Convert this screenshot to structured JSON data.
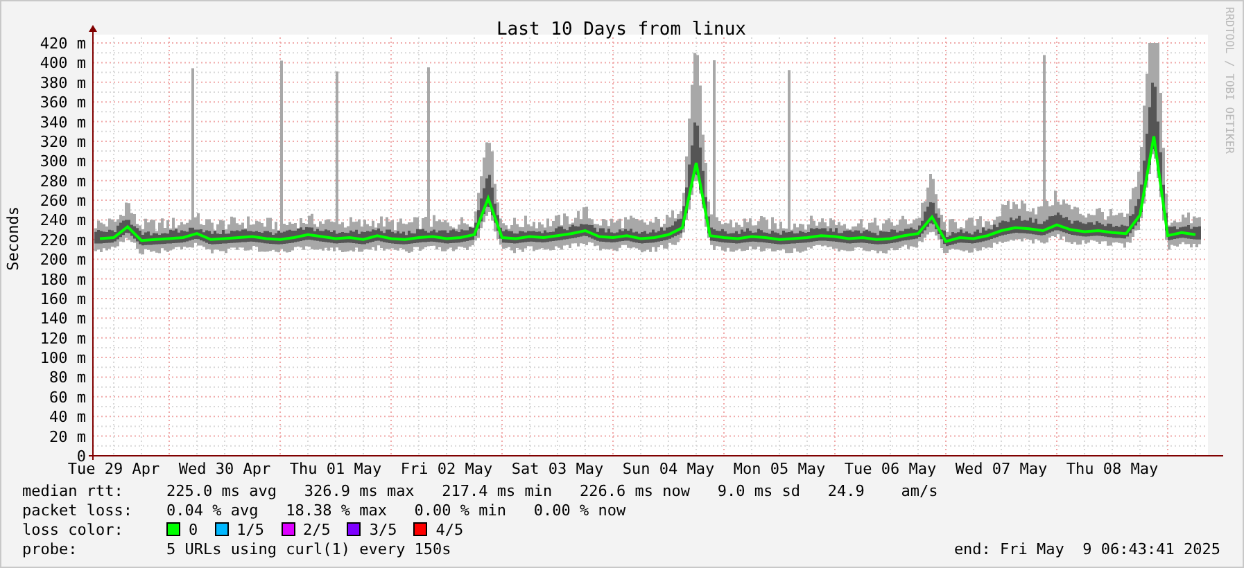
{
  "chart": {
    "watermark": "RRDTOOL / TOBI OETIKER",
    "chart_data": {
      "type": "line",
      "title": "Last 10 Days from linux",
      "ylabel": "Seconds",
      "grid": true,
      "ylim": [
        0,
        420
      ],
      "categories": [
        null,
        "Tue 29 Apr",
        null,
        null,
        null,
        null,
        null,
        null,
        null,
        "Wed 30 Apr",
        null,
        null,
        null,
        null,
        null,
        null,
        null,
        "Thu 01 May",
        null,
        null,
        null,
        null,
        null,
        null,
        null,
        "Fri 02 May",
        null,
        null,
        null,
        null,
        null,
        null,
        null,
        "Sat 03 May",
        null,
        null,
        null,
        null,
        null,
        null,
        null,
        "Sun 04 May",
        null,
        null,
        null,
        null,
        null,
        null,
        null,
        "Mon 05 May",
        null,
        null,
        null,
        null,
        null,
        null,
        null,
        "Tue 06 May",
        null,
        null,
        null,
        null,
        null,
        null,
        null,
        "Wed 07 May",
        null,
        null,
        null,
        null,
        null,
        null,
        null,
        "Thu 08 May",
        null,
        null,
        null,
        null,
        null,
        null
      ],
      "yticks": [
        {
          "value": 0,
          "label": "0"
        },
        {
          "value": 20,
          "label": "20 m"
        },
        {
          "value": 40,
          "label": "40 m"
        },
        {
          "value": 60,
          "label": "60 m"
        },
        {
          "value": 80,
          "label": "80 m"
        },
        {
          "value": 100,
          "label": "100 m"
        },
        {
          "value": 120,
          "label": "120 m"
        },
        {
          "value": 140,
          "label": "140 m"
        },
        {
          "value": 160,
          "label": "160 m"
        },
        {
          "value": 180,
          "label": "180 m"
        },
        {
          "value": 200,
          "label": "200 m"
        },
        {
          "value": 220,
          "label": "220 m"
        },
        {
          "value": 240,
          "label": "240 m"
        },
        {
          "value": 260,
          "label": "260 m"
        },
        {
          "value": 280,
          "label": "280 m"
        },
        {
          "value": 300,
          "label": "300 m"
        },
        {
          "value": 320,
          "label": "320 m"
        },
        {
          "value": 340,
          "label": "340 m"
        },
        {
          "value": 360,
          "label": "360 m"
        },
        {
          "value": 380,
          "label": "380 m"
        },
        {
          "value": 400,
          "label": "400 m"
        },
        {
          "value": 420,
          "label": "420 m"
        }
      ],
      "series": [
        {
          "color": "#00ff00",
          "values": [
            221,
            222,
            233,
            219,
            220,
            221,
            222,
            226,
            220,
            221,
            222,
            223,
            221,
            220,
            222,
            225,
            223,
            221,
            222,
            220,
            224,
            221,
            220,
            222,
            223,
            221,
            222,
            225,
            262,
            222,
            221,
            223,
            222,
            224,
            226,
            229,
            223,
            222,
            224,
            221,
            222,
            225,
            232,
            298,
            224,
            222,
            221,
            223,
            222,
            220,
            221,
            222,
            224,
            223,
            221,
            222,
            220,
            221,
            224,
            226,
            243,
            218,
            222,
            221,
            224,
            229,
            232,
            231,
            229,
            235,
            230,
            228,
            229,
            227,
            226,
            245,
            325,
            224,
            227,
            225
          ]
        }
      ]
    }
  },
  "legend": {
    "rows": [
      {
        "label": "median rtt:",
        "text": "225.0 ms avg   326.9 ms max   217.4 ms min   226.6 ms now   9.0 ms sd   24.9    am/s"
      },
      {
        "label": "packet loss:",
        "text": "0.04 % avg   18.38 % max   0.00 % min   0.00 % now"
      }
    ],
    "loss": {
      "label": "loss color:",
      "items": [
        {
          "label": "0",
          "color": "#00ff00"
        },
        {
          "label": "1/5",
          "color": "#00b8ff"
        },
        {
          "label": "2/5",
          "color": "#dd00ff"
        },
        {
          "label": "3/5",
          "color": "#7e00ff"
        },
        {
          "label": "4/5",
          "color": "#ff0000"
        }
      ]
    },
    "probe": {
      "label": "probe:",
      "text": "5 URLs using curl(1) every 150s",
      "end": "end: Fri May  9 06:43:41 2025"
    }
  }
}
